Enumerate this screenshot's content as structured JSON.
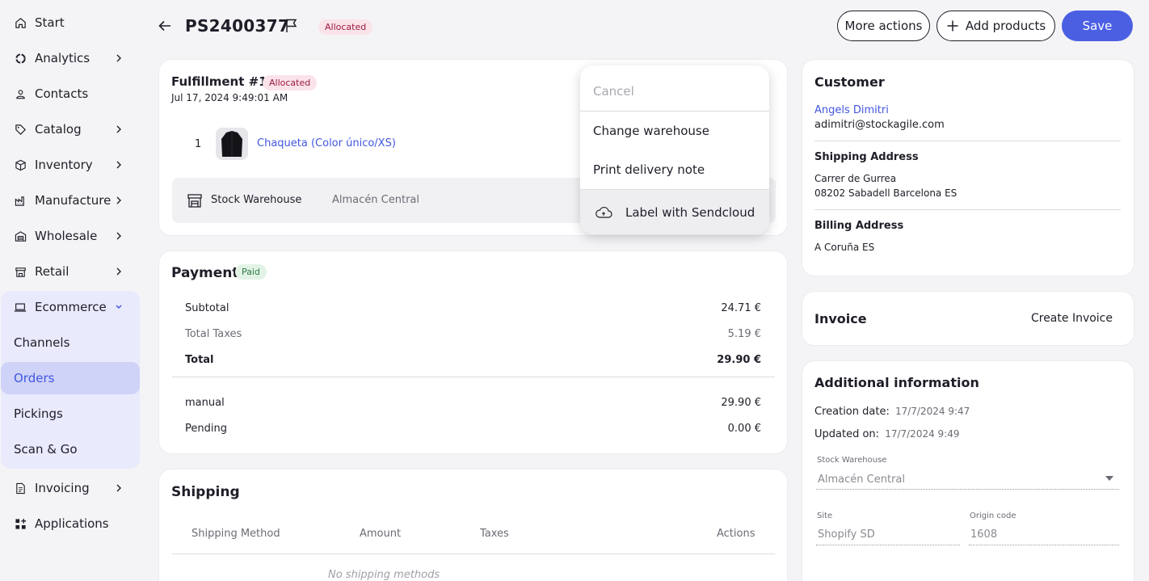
{
  "sidebar": {
    "items": [
      {
        "label": "Start",
        "icon": "home-icon"
      },
      {
        "label": "Analytics",
        "icon": "analytics-icon"
      },
      {
        "label": "Contacts",
        "icon": "user-icon"
      },
      {
        "label": "Catalog",
        "icon": "tag-icon"
      },
      {
        "label": "Inventory",
        "icon": "box-icon"
      },
      {
        "label": "Manufacture",
        "icon": "factory-icon"
      },
      {
        "label": "Wholesale",
        "icon": "warehouse-icon"
      },
      {
        "label": "Retail",
        "icon": "store-icon"
      },
      {
        "label": "Ecommerce",
        "icon": "laptop-icon"
      },
      {
        "label": "Invoicing",
        "icon": "document-icon"
      },
      {
        "label": "Applications",
        "icon": "apps-icon"
      }
    ],
    "ecommerce_sub": [
      "Channels",
      "Orders",
      "Pickings",
      "Scan & Go"
    ]
  },
  "header": {
    "order_id": "PS2400377",
    "status": "Allocated",
    "more_actions": "More actions",
    "add_products": "Add products",
    "save": "Save"
  },
  "fulfillment": {
    "title": "Fulfillment #1",
    "status": "Allocated",
    "date": "Jul 17, 2024 9:49:01 AM",
    "line_qty": "1",
    "product": "Chaqueta (Color único/XS)",
    "warehouse_label": "Stock Warehouse",
    "warehouse_value": "Almacén Central"
  },
  "dropdown": {
    "cancel": "Cancel",
    "change_warehouse": "Change warehouse",
    "print_delivery": "Print delivery note",
    "label_sendcloud": "Label with Sendcloud"
  },
  "payment": {
    "title": "Payment",
    "status": "Paid",
    "subtotal_label": "Subtotal",
    "subtotal": "24.71 €",
    "taxes_label": "Total Taxes",
    "taxes": "5.19 €",
    "total_label": "Total",
    "total": "29.90 €",
    "manual_label": "manual",
    "manual": "29.90 €",
    "pending_label": "Pending",
    "pending": "0.00 €"
  },
  "shipping": {
    "title": "Shipping",
    "columns": [
      "Shipping Method",
      "Amount",
      "Taxes",
      "Actions"
    ],
    "empty": "No shipping methods"
  },
  "customer": {
    "title": "Customer",
    "name": "Angels Dimitri",
    "email": "adimitri@stockagile.com",
    "shipping_title": "Shipping Address",
    "shipping_line1": "Carrer de Gurrea",
    "shipping_line2": "08202 Sabadell Barcelona ES",
    "billing_title": "Billing Address",
    "billing_line1": "A Coruña ES"
  },
  "invoice": {
    "title": "Invoice",
    "create": "Create Invoice"
  },
  "additional": {
    "title": "Additional information",
    "creation_label": "Creation date:",
    "creation_value": "17/7/2024 9:47",
    "updated_label": "Updated on:",
    "updated_value": "17/7/2024 9:49",
    "warehouse_label": "Stock Warehouse",
    "warehouse_value": "Almacén Central",
    "site_label": "Site",
    "site_value": "Shopify SD",
    "origin_label": "Origin code",
    "origin_value": "1608"
  }
}
